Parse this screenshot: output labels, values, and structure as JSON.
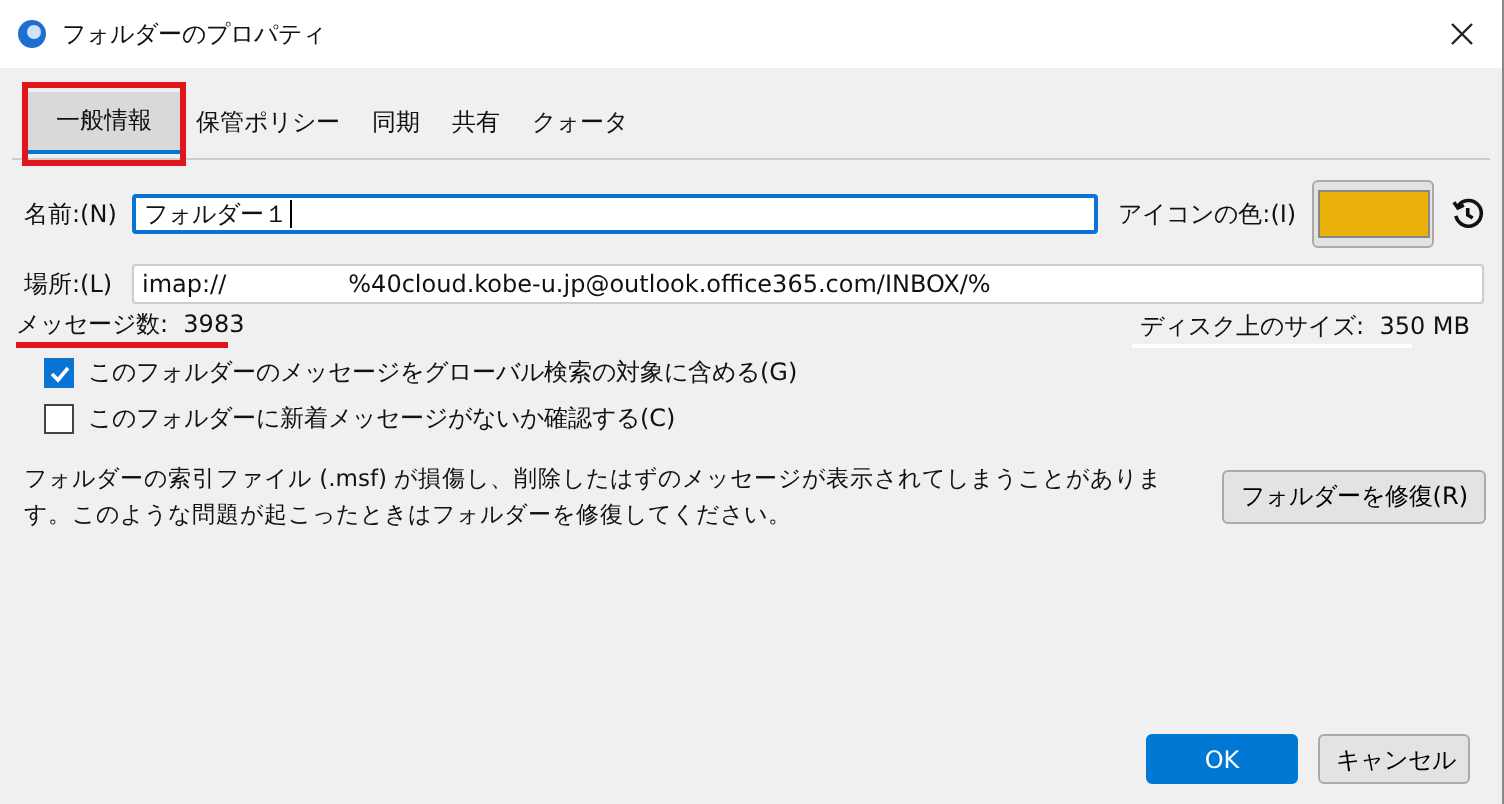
{
  "window": {
    "title": "フォルダーのプロパティ"
  },
  "tabs": [
    {
      "label": "一般情報",
      "selected": true,
      "highlighted": true
    },
    {
      "label": "保管ポリシー",
      "selected": false,
      "highlighted": false
    },
    {
      "label": "同期",
      "selected": false,
      "highlighted": false
    },
    {
      "label": "共有",
      "selected": false,
      "highlighted": false
    },
    {
      "label": "クォータ",
      "selected": false,
      "highlighted": false
    }
  ],
  "name": {
    "label": "名前:(N)",
    "value": "フォルダー１"
  },
  "icon_color": {
    "label": "アイコンの色:(I)",
    "color": "#e9b10a"
  },
  "location": {
    "label": "場所:(L)",
    "value": "imap://                %40cloud.kobe-u.jp@outlook.office365.com/INBOX/%"
  },
  "message_count": {
    "label": "メッセージ数:",
    "value": "3983",
    "underline": {
      "color": "#e0161d"
    }
  },
  "disk_size": {
    "label": "ディスク上のサイズ:",
    "value": "350 MB",
    "underline": {
      "color": "#ffffff"
    }
  },
  "options": [
    {
      "label": "このフォルダーのメッセージをグローバル検索の対象に含める(G)",
      "checked": true
    },
    {
      "label": "このフォルダーに新着メッセージがないか確認する(C)",
      "checked": false
    }
  ],
  "repair": {
    "text": "フォルダーの索引ファイル (.msf) が損傷し、削除したはずのメッセージが表示されてしまうことがあります。このような問題が起こったときはフォルダーを修復してください。",
    "button": "フォルダーを修復(R)"
  },
  "buttons": [
    "OK",
    "キャンセル"
  ]
}
